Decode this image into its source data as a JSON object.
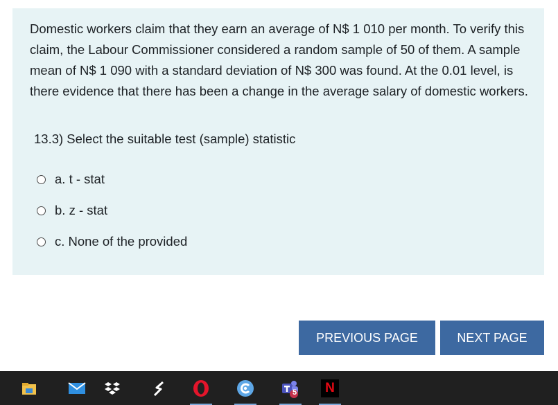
{
  "question": {
    "text": "Domestic workers claim that they earn an average of N$ 1 010 per month. To verify this claim, the Labour Commissioner considered a random sample of 50 of them. A sample mean of N$ 1 090 with a standard deviation of N$ 300 was found.  At the 0.01 level, is there evidence that there has been a change in the average salary of domestic workers.",
    "prompt": "13.3) Select the suitable test (sample) statistic",
    "options": [
      {
        "label": "a. t - stat"
      },
      {
        "label": "b. z - stat"
      },
      {
        "label": "c. None of the provided"
      }
    ]
  },
  "navigation": {
    "previous_label": "PREVIOUS PAGE",
    "next_label": "NEXT PAGE"
  },
  "taskbar": {
    "apps": [
      {
        "icon": "file-explorer-icon"
      },
      {
        "icon": "mail-icon"
      },
      {
        "icon": "dropbox-icon"
      },
      {
        "icon": "s-logo-icon"
      },
      {
        "icon": "opera-icon"
      },
      {
        "icon": "browser-swirl-icon"
      },
      {
        "icon": "teams-icon",
        "badge": "5"
      },
      {
        "icon": "netflix-icon",
        "letter": "N"
      }
    ]
  },
  "colors": {
    "card_background": "#e7f3f5",
    "button_background": "#3d69a1",
    "taskbar_background": "#202020"
  }
}
